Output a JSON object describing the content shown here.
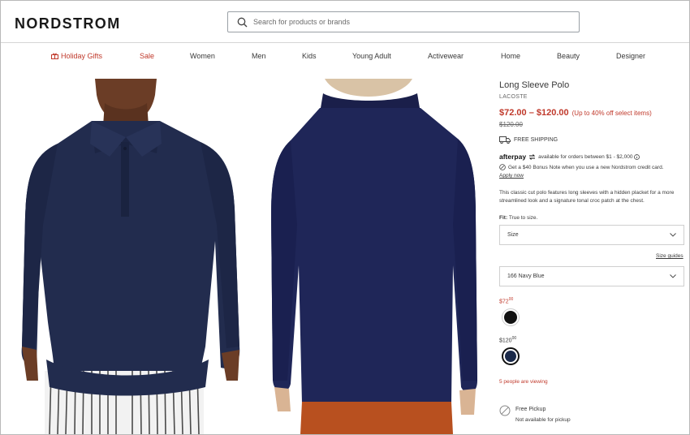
{
  "header": {
    "logo": "NORDSTROM",
    "search_placeholder": "Search for products or brands"
  },
  "nav": {
    "items": [
      {
        "label": "Holiday Gifts",
        "highlight": true
      },
      {
        "label": "Sale",
        "highlight": true
      },
      {
        "label": "Women",
        "highlight": false
      },
      {
        "label": "Men",
        "highlight": false
      },
      {
        "label": "Kids",
        "highlight": false
      },
      {
        "label": "Young Adult",
        "highlight": false
      },
      {
        "label": "Activewear",
        "highlight": false
      },
      {
        "label": "Home",
        "highlight": false
      },
      {
        "label": "Beauty",
        "highlight": false
      },
      {
        "label": "Designer",
        "highlight": false
      }
    ],
    "highlight_color": "#c0392b"
  },
  "product": {
    "title": "Long Sleeve Polo",
    "brand": "LACOSTE",
    "price_range": "$72.00 – $120.00",
    "discount_text": "(Up to 40% off select items)",
    "original_price": "$120.00",
    "shipping": "FREE SHIPPING",
    "afterpay_logo": "afterpay",
    "afterpay_text": "available for orders between $1 - $2,000",
    "bonus_text": "Get a $40 Bonus Note when you use a new Nordstrom credit card.",
    "apply_link": "Apply now",
    "description": "This classic cut polo features long sleeves with a hidden placket for a more streamlined look and a signature tonal croc patch at the chest.",
    "fit_label": "Fit:",
    "fit_value": "True to size.",
    "size_select": "Size",
    "size_guides": "Size guides",
    "color_select": "166 Navy Blue",
    "swatch_groups": [
      {
        "price_main": "$72",
        "price_cents": "00",
        "color": "#111111",
        "selected": false
      },
      {
        "price_main": "$120",
        "price_cents": "00",
        "color": "#1b2a4a",
        "selected": true
      }
    ],
    "viewing": "5 people are viewing",
    "pickup_title": "Free Pickup",
    "pickup_sub": "Not available for pickup"
  },
  "colors": {
    "sale_red": "#c0392b",
    "navy": "#1b2a4a"
  }
}
